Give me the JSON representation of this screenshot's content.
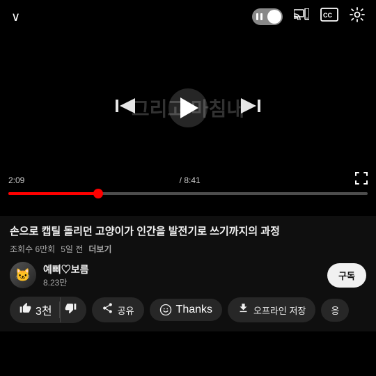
{
  "player": {
    "title_overlay": "그리고 마침내",
    "current_time": "2:09",
    "total_time": "8:41",
    "progress_percent": 25
  },
  "controls": {
    "chevron_down": "∨",
    "prev_icon": "⏮",
    "play_icon": "▶",
    "next_icon": "⏭",
    "cast_icon": "⊡",
    "cc_icon": "CC",
    "settings_icon": "⚙"
  },
  "video": {
    "title": "손으로 캡틸 돌리던 고양이가 인간을 발전기로 쓰기까지의 과정",
    "views": "조회수 6만회",
    "time_ago": "5일 전",
    "more_label": "더보기"
  },
  "channel": {
    "name": "예삐♡보름",
    "subscribers": "8.23만",
    "avatar_emoji": "🐱",
    "subscribe_label": "구독"
  },
  "actions": {
    "like_count": "3천",
    "share_label": "공유",
    "thanks_label": "Thanks",
    "download_label": "오프라인 저장",
    "more_label": "응"
  }
}
